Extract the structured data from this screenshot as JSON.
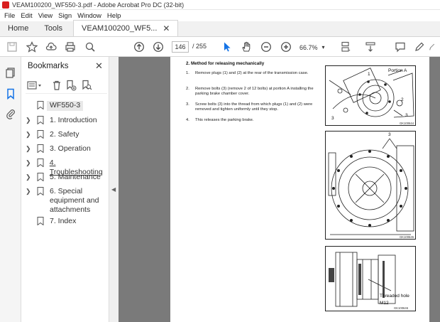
{
  "window": {
    "title": "VEAM100200_WF550-3.pdf - Adobe Acrobat Pro DC (32-bit)"
  },
  "menu": [
    "File",
    "Edit",
    "View",
    "Sign",
    "Window",
    "Help"
  ],
  "tabs": {
    "home": "Home",
    "tools": "Tools",
    "document": "VEAM100200_WF5..."
  },
  "toolbar": {
    "current_page": "146",
    "total_pages": "/ 255",
    "zoom": "66.7%"
  },
  "bookmarks": {
    "header": "Bookmarks",
    "items": [
      {
        "label": "WF550-3",
        "expandable": false
      },
      {
        "label": "1.  Introduction",
        "expandable": true
      },
      {
        "label": "2.  Safety",
        "expandable": true
      },
      {
        "label": "3.  Operation",
        "expandable": true
      },
      {
        "label": "4.  Troubleshooting",
        "expandable": true
      },
      {
        "label": "5.  Maintenance",
        "expandable": true
      },
      {
        "label": "6.  Special equipment and attachments",
        "expandable": true
      },
      {
        "label": "7.  Index",
        "expandable": false
      }
    ]
  },
  "document": {
    "heading": "2.   Method for releasing mechanically",
    "steps": [
      {
        "n": "1.",
        "text": "Remove plugs (1) and (2) at the rear of the transmission case."
      },
      {
        "n": "2.",
        "text": "Remove bolts (3) (remove 2 of 12 bolts) at portion A installing the parking brake chamber cover."
      },
      {
        "n": "3.",
        "text": "Screw bolts (3) into the thread from which plugs (1) and (2) were removed and tighten uniformly until they stop."
      },
      {
        "n": "4.",
        "text": "This releases the parking brake."
      }
    ],
    "figures": [
      {
        "labels": {
          "portion": "Portion A",
          "one": "1",
          "two": "2",
          "three": "3"
        },
        "code": "GK100644"
      },
      {
        "labels": {
          "three": "3"
        },
        "code": "GK100645"
      },
      {
        "labels": {
          "hole": "Threaded hole",
          "size": "M12"
        },
        "code": "GK100646"
      }
    ]
  },
  "colors": {
    "accent_blue": "#1473e6",
    "acrobat_red": "#d81e1e",
    "viewer_gray": "#7a7a7a"
  }
}
